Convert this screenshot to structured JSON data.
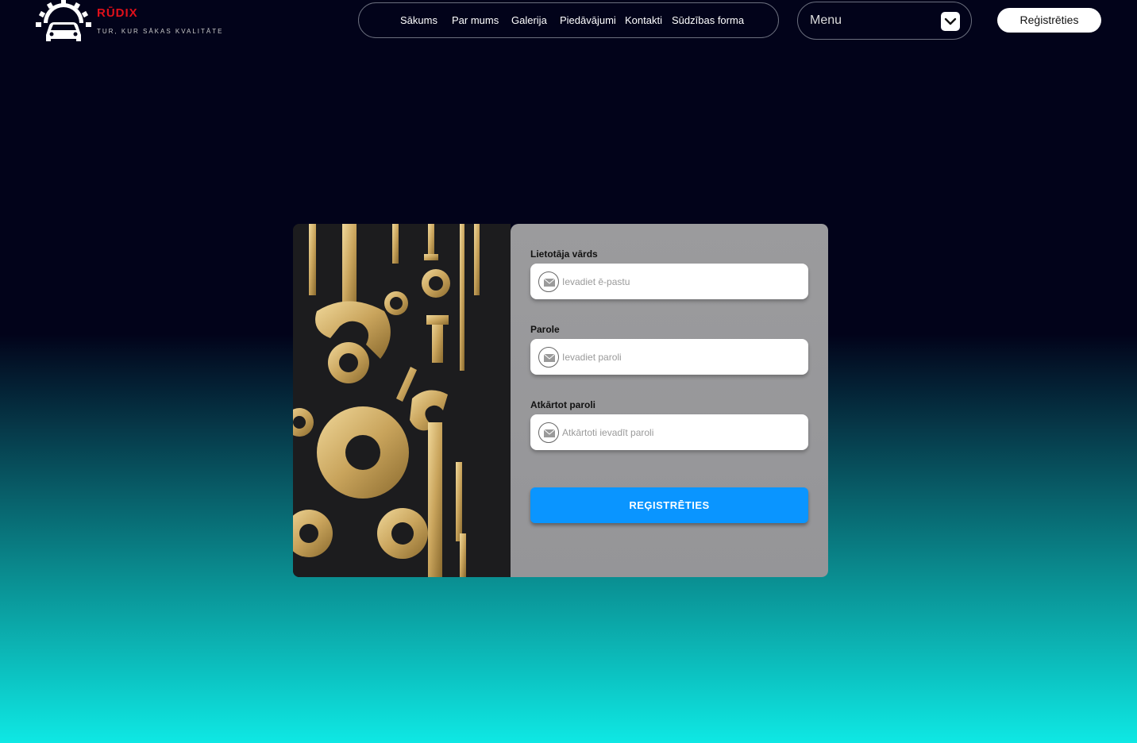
{
  "brand": {
    "name": "RŪDIX",
    "tagline": "TUR, KUR SĀKAS KVALITĀTE",
    "name_color": "#e0101a"
  },
  "nav": {
    "items": [
      "Sākums",
      "Par mums",
      "Galerija",
      "Piedāvājumi",
      "Kontakti",
      "Sūdzības forma"
    ]
  },
  "menu": {
    "label": "Menu",
    "icon": "chevron-down-icon"
  },
  "header_button": {
    "label": "Reģistrēties"
  },
  "form": {
    "username": {
      "label": "Lietotāja vārds",
      "placeholder": "Ievadiet ē-pastu",
      "icon": "mail-icon"
    },
    "password": {
      "label": "Parole",
      "placeholder": "Ievadiet paroli",
      "icon": "mail-icon"
    },
    "password_repeat": {
      "label": "Atkārtot paroli",
      "placeholder": "Atkārtoti ievadīt paroli",
      "icon": "mail-icon"
    },
    "submit_label": "REĢISTRĒTIES",
    "submit_color": "#0a95ff"
  },
  "image": {
    "subject": "tools-photo"
  }
}
